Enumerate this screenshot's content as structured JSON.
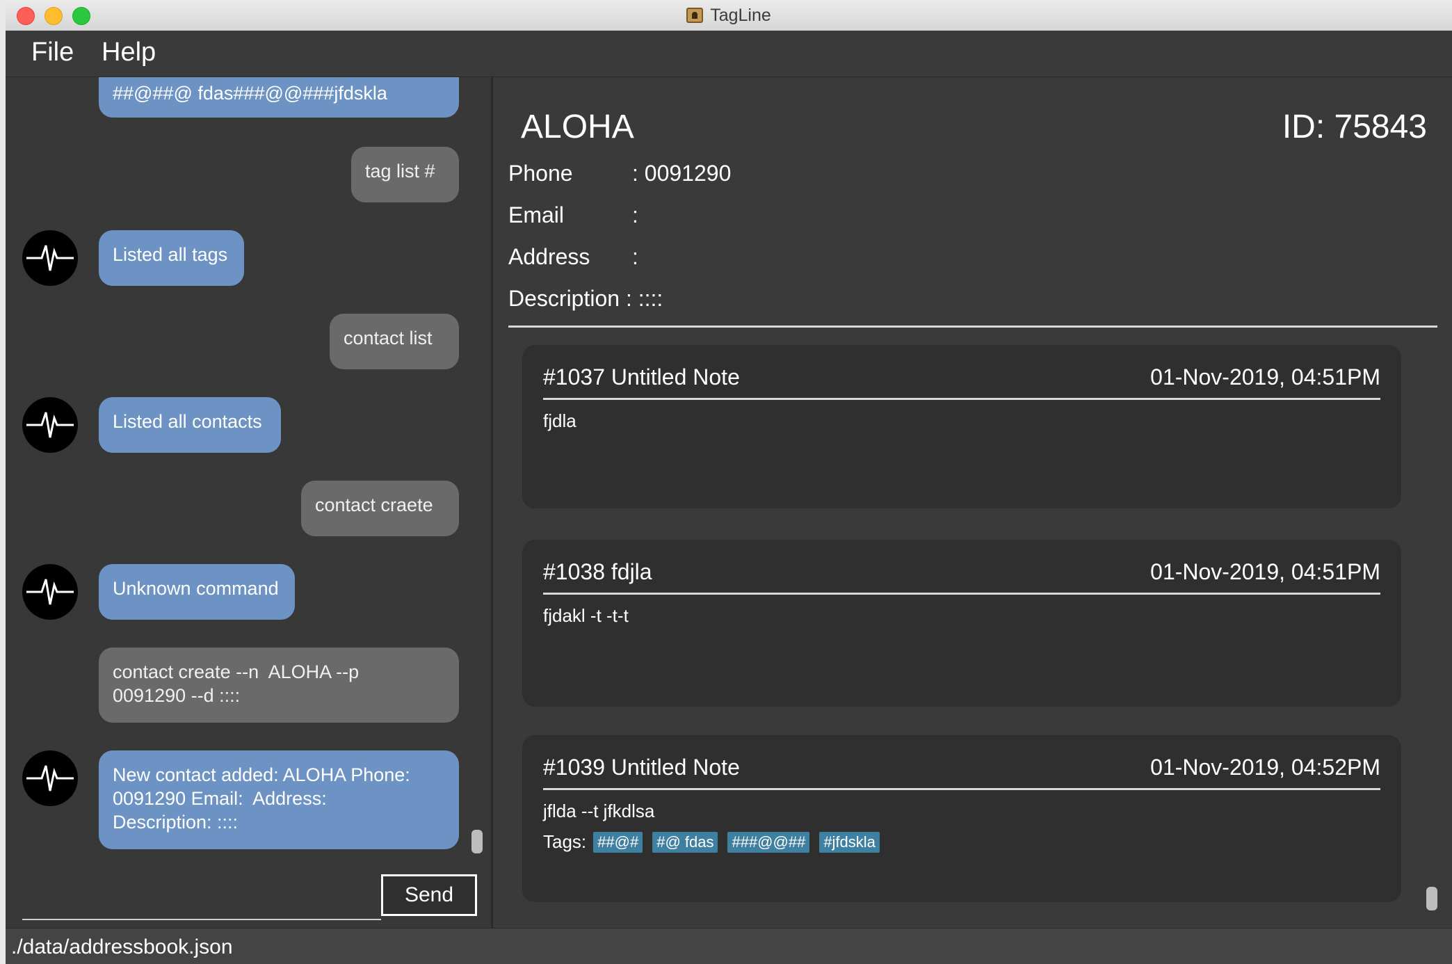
{
  "window": {
    "title": "TagLine"
  },
  "menu": {
    "file": "File",
    "help": "Help"
  },
  "chat": {
    "messages": [
      {
        "role": "bot",
        "text": "##@##@ fdas###@@###jfdskla"
      },
      {
        "role": "user",
        "text": "tag list #"
      },
      {
        "role": "bot",
        "text": "Listed all tags"
      },
      {
        "role": "user",
        "text": "contact list"
      },
      {
        "role": "bot",
        "text": "Listed all contacts"
      },
      {
        "role": "user",
        "text": "contact craete"
      },
      {
        "role": "bot",
        "text": "Unknown command"
      },
      {
        "role": "user",
        "text": "contact create --n  ALOHA --p\n0091290 --d ::::"
      },
      {
        "role": "bot",
        "text": "New contact added: ALOHA Phone:\n0091290 Email:  Address:\nDescription: ::::"
      }
    ],
    "input_value": "",
    "send_label": "Send"
  },
  "contact": {
    "name": "ALOHA",
    "id": "ID: 75843",
    "phone_label": "Phone",
    "phone_value": ": 0091290",
    "email_label": "Email",
    "email_value": ":",
    "address_label": "Address",
    "address_value": ":",
    "description_label": "Description : ::::"
  },
  "notes": [
    {
      "title": "#1037 Untitled Note",
      "date": "01-Nov-2019, 04:51PM",
      "body": "fjdla",
      "tags": []
    },
    {
      "title": "#1038 fdjla",
      "date": "01-Nov-2019, 04:51PM",
      "body": "fjdakl -t -t-t",
      "tags": []
    },
    {
      "title": "#1039 Untitled Note",
      "date": "01-Nov-2019, 04:52PM",
      "body": "jflda --t jfkdlsa",
      "tags_label": "Tags:",
      "tags": [
        "##@#",
        "#@ fdas",
        "###@@##",
        "#jfdskla"
      ]
    }
  ],
  "status": {
    "path": "./data/addressbook.json"
  }
}
